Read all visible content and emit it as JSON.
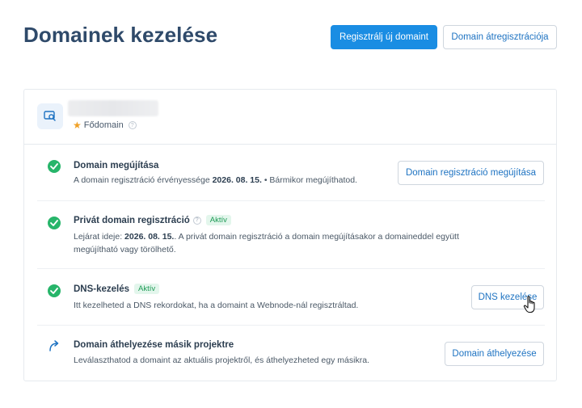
{
  "header": {
    "title": "Domainek kezelése",
    "register_button": "Regisztrálj új domaint",
    "transfer_button": "Domain átregisztrációja"
  },
  "domain_card": {
    "primary_label": "Fődomain",
    "rows": [
      {
        "title": "Domain megújítása",
        "desc_before": "A domain regisztráció érvényessége ",
        "desc_date": "2026. 08. 15.",
        "desc_after": " • Bármikor megújíthatod.",
        "button": "Domain regisztráció megújítása",
        "status": "check"
      },
      {
        "title": "Privát domain regisztráció",
        "badge": "Aktív",
        "desc_before": "Lejárat ideje: ",
        "desc_date": "2026. 08. 15.",
        "desc_after": ". A privát domain regisztráció a domain megújításakor a domaineddel együtt megújítható vagy törölhető.",
        "status": "check"
      },
      {
        "title": "DNS-kezelés",
        "badge": "Aktív",
        "desc": "Itt kezelheted a DNS rekordokat, ha a domaint a Webnode-nál regisztráltad.",
        "button": "DNS kezelése",
        "status": "check"
      },
      {
        "title": "Domain áthelyezése másik projektre",
        "desc": "Leválaszthatod a domaint az aktuális projektről, és áthelyezheted egy másikra.",
        "button": "Domain áthelyezése",
        "status": "arrow"
      }
    ]
  },
  "colors": {
    "accent": "#1a8de3",
    "success": "#27b56a",
    "title": "#2f4a6a"
  },
  "icons": {
    "domain": "domain-search-icon",
    "check": "check-circle-icon",
    "move": "curved-arrow-icon",
    "info": "info-icon",
    "star": "star-icon",
    "cursor": "hand-cursor-icon"
  }
}
